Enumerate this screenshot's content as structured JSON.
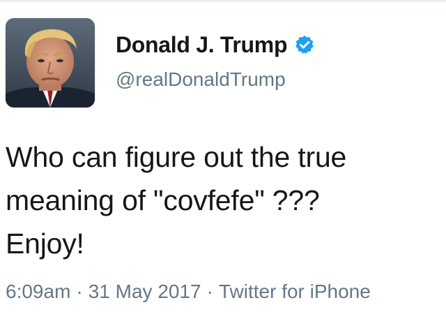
{
  "tweet": {
    "author": {
      "name": "Donald J. Trump",
      "handle": "@realDonaldTrump",
      "verified": true,
      "verified_color": "#1da1f2"
    },
    "text": "Who can figure out the true\nmeaning of \"covfefe\" ???\nEnjoy!",
    "meta": {
      "time": "6:09am",
      "separator": "·",
      "date": "31 May 2017",
      "source": "Twitter for iPhone"
    }
  },
  "icons": {
    "avatar": "profile-photo",
    "verified": "verified-badge-icon"
  },
  "colors": {
    "text": "#14171a",
    "secondary": "#657786",
    "border": "#e6ecf0"
  }
}
